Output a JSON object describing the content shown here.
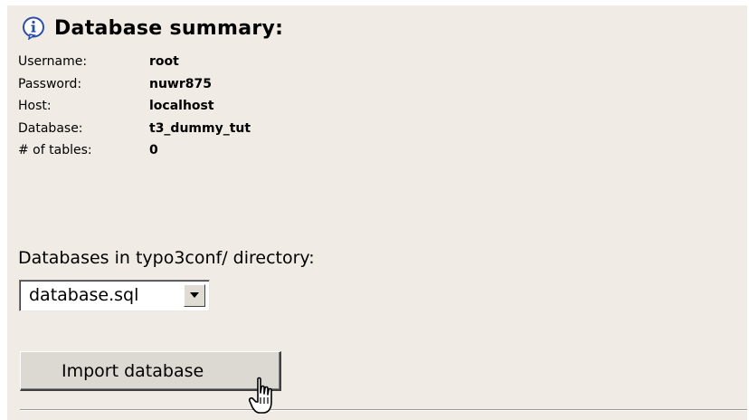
{
  "summary": {
    "heading": "Database summary:",
    "icon": "info-icon",
    "rows": [
      {
        "label": "Username:",
        "value": "root"
      },
      {
        "label": "Password:",
        "value": "nuwr875"
      },
      {
        "label": "Host:",
        "value": "localhost"
      },
      {
        "label": "Database:",
        "value": "t3_dummy_tut"
      },
      {
        "label": "# of tables:",
        "value": "0"
      }
    ]
  },
  "import": {
    "dir_label": "Databases in typo3conf/ directory:",
    "selected_file": "database.sql",
    "button_label": "Import database"
  },
  "colors": {
    "panel_bg": "#f0ebe4",
    "info_icon_blue": "#2b4ea8"
  }
}
